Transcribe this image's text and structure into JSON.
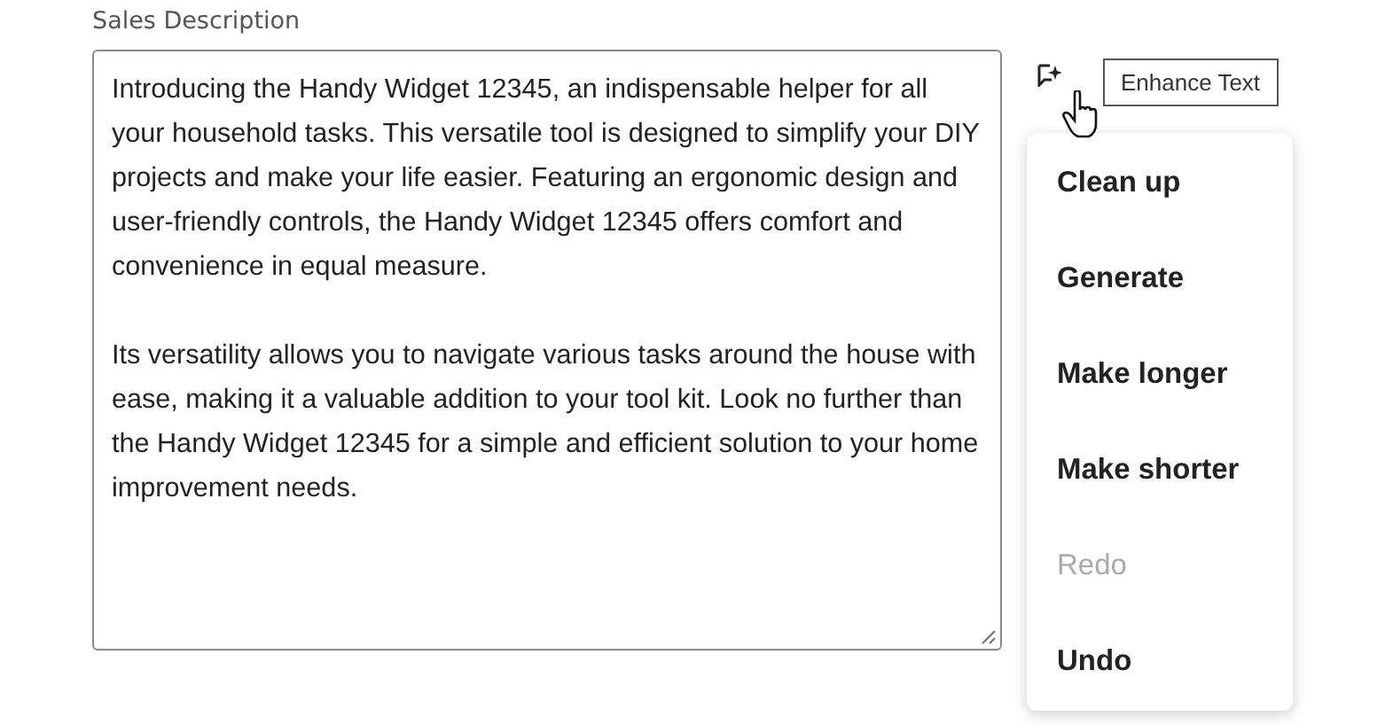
{
  "field": {
    "label": "Sales Description",
    "paragraphs": [
      "Introducing the Handy Widget 12345, an indispensable helper for all your household tasks. This versatile tool is designed to simplify your DIY projects and make your life easier. Featuring an ergonomic design and user-friendly controls, the Handy Widget 12345 offers comfort and convenience in equal measure.",
      "Its versatility allows you to navigate various tasks around the house with ease, making it a valuable addition to your tool kit. Look no further than the Handy Widget 12345 for a simple and efficient solution to your home improvement needs."
    ]
  },
  "tooltip": "Enhance Text",
  "menu": [
    {
      "label": "Clean up",
      "disabled": false
    },
    {
      "label": "Generate",
      "disabled": false
    },
    {
      "label": "Make longer",
      "disabled": false
    },
    {
      "label": "Make shorter",
      "disabled": false
    },
    {
      "label": "Redo",
      "disabled": true
    },
    {
      "label": "Undo",
      "disabled": false
    }
  ]
}
